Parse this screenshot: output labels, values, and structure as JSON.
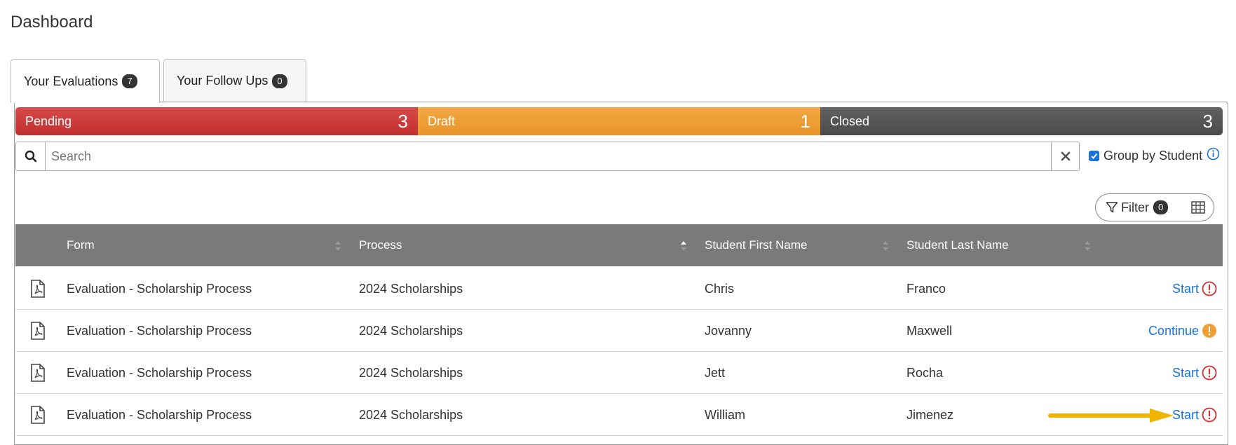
{
  "page": {
    "title": "Dashboard"
  },
  "tabs": [
    {
      "label": "Your Evaluations",
      "count": "7"
    },
    {
      "label": "Your Follow Ups",
      "count": "0"
    }
  ],
  "status": {
    "pending": {
      "label": "Pending",
      "count": "3",
      "color": "#d03b3b"
    },
    "draft": {
      "label": "Draft",
      "count": "1",
      "color": "#eea036"
    },
    "closed": {
      "label": "Closed",
      "count": "3",
      "color": "#555555"
    }
  },
  "search": {
    "placeholder": "Search",
    "value": ""
  },
  "group_by": {
    "label": "Group by Student",
    "checked": true
  },
  "filter": {
    "label": "Filter",
    "count": "0"
  },
  "table": {
    "columns": [
      "Form",
      "Process",
      "Student First Name",
      "Student Last Name"
    ],
    "rows": [
      {
        "form": "Evaluation - Scholarship Process",
        "process": "2024 Scholarships",
        "first": "Chris",
        "last": "Franco",
        "action": "Start",
        "status_icon": "alert-red-icon"
      },
      {
        "form": "Evaluation - Scholarship Process",
        "process": "2024 Scholarships",
        "first": "Jovanny",
        "last": "Maxwell",
        "action": "Continue",
        "status_icon": "alert-orange-icon"
      },
      {
        "form": "Evaluation - Scholarship Process",
        "process": "2024 Scholarships",
        "first": "Jett",
        "last": "Rocha",
        "action": "Start",
        "status_icon": "alert-red-icon"
      },
      {
        "form": "Evaluation - Scholarship Process",
        "process": "2024 Scholarships",
        "first": "William",
        "last": "Jimenez",
        "action": "Start",
        "status_icon": "alert-red-icon"
      }
    ]
  },
  "colors": {
    "accent": "#1a73d9",
    "header_bg": "#7a7a7a",
    "annotation_arrow": "#f0b400"
  }
}
